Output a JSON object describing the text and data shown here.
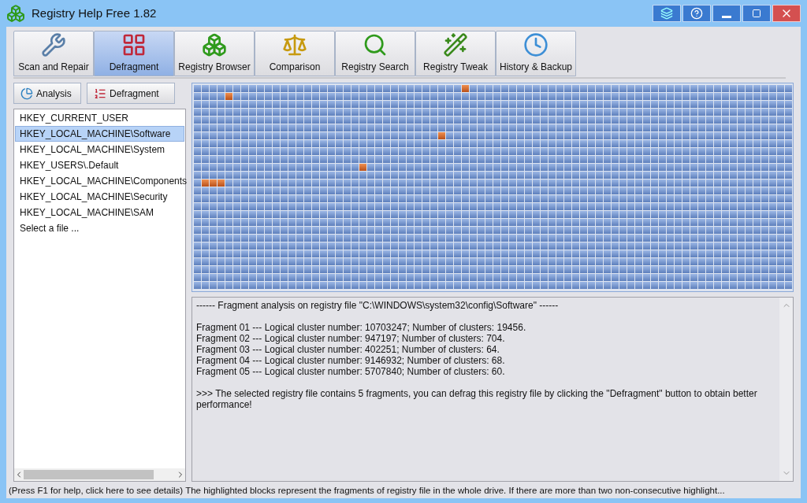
{
  "window": {
    "title": "Registry Help Free 1.82"
  },
  "tabs": [
    {
      "label": "Scan and Repair",
      "kind": "wrench",
      "selected": false
    },
    {
      "label": "Defragment",
      "kind": "blocks",
      "selected": true
    },
    {
      "label": "Registry Browser",
      "kind": "cubes",
      "selected": false
    },
    {
      "label": "Comparison",
      "kind": "scale",
      "selected": false
    },
    {
      "label": "Registry Search",
      "kind": "search",
      "selected": false
    },
    {
      "label": "Registry Tweak",
      "kind": "wand",
      "selected": false
    },
    {
      "label": "History & Backup",
      "kind": "clock",
      "selected": false
    }
  ],
  "toolbar": [
    {
      "label": "Analysis",
      "kind": "analysis"
    },
    {
      "label": "Defragment",
      "kind": "defrag"
    }
  ],
  "registry_files": [
    {
      "label": "HKEY_CURRENT_USER",
      "selected": false
    },
    {
      "label": "HKEY_LOCAL_MACHINE\\Software",
      "selected": true
    },
    {
      "label": "HKEY_LOCAL_MACHINE\\System",
      "selected": false
    },
    {
      "label": "HKEY_USERS\\.Default",
      "selected": false
    },
    {
      "label": "HKEY_LOCAL_MACHINE\\Components",
      "selected": false
    },
    {
      "label": "HKEY_LOCAL_MACHINE\\Security",
      "selected": false
    },
    {
      "label": "HKEY_LOCAL_MACHINE\\SAM",
      "selected": false
    },
    {
      "label": "Select a file ...",
      "selected": false
    }
  ],
  "analysis_output": {
    "header": "------ Fragment analysis on registry file \"C:\\WINDOWS\\system32\\config\\Software\" ------",
    "fragments": [
      "Fragment 01 --- Logical cluster number: 10703247; Number of clusters: 19456.",
      "Fragment 02 --- Logical cluster number: 947197; Number of clusters: 704.",
      "Fragment 03 --- Logical cluster number: 402251; Number of clusters: 64.",
      "Fragment 04 --- Logical cluster number: 9146932; Number of clusters: 68.",
      "Fragment 05 --- Logical cluster number: 5707840; Number of clusters: 60."
    ],
    "summary": ">>> The selected registry file contains 5 fragments, you can defrag this registry file by clicking the \"Defragment\" button to obtain better performance!"
  },
  "status_bar": "(Press F1 for help, click here to see details) The highlighted blocks represent the fragments of registry file in the whole drive. If there are more than two non-consecutive highlight..."
}
